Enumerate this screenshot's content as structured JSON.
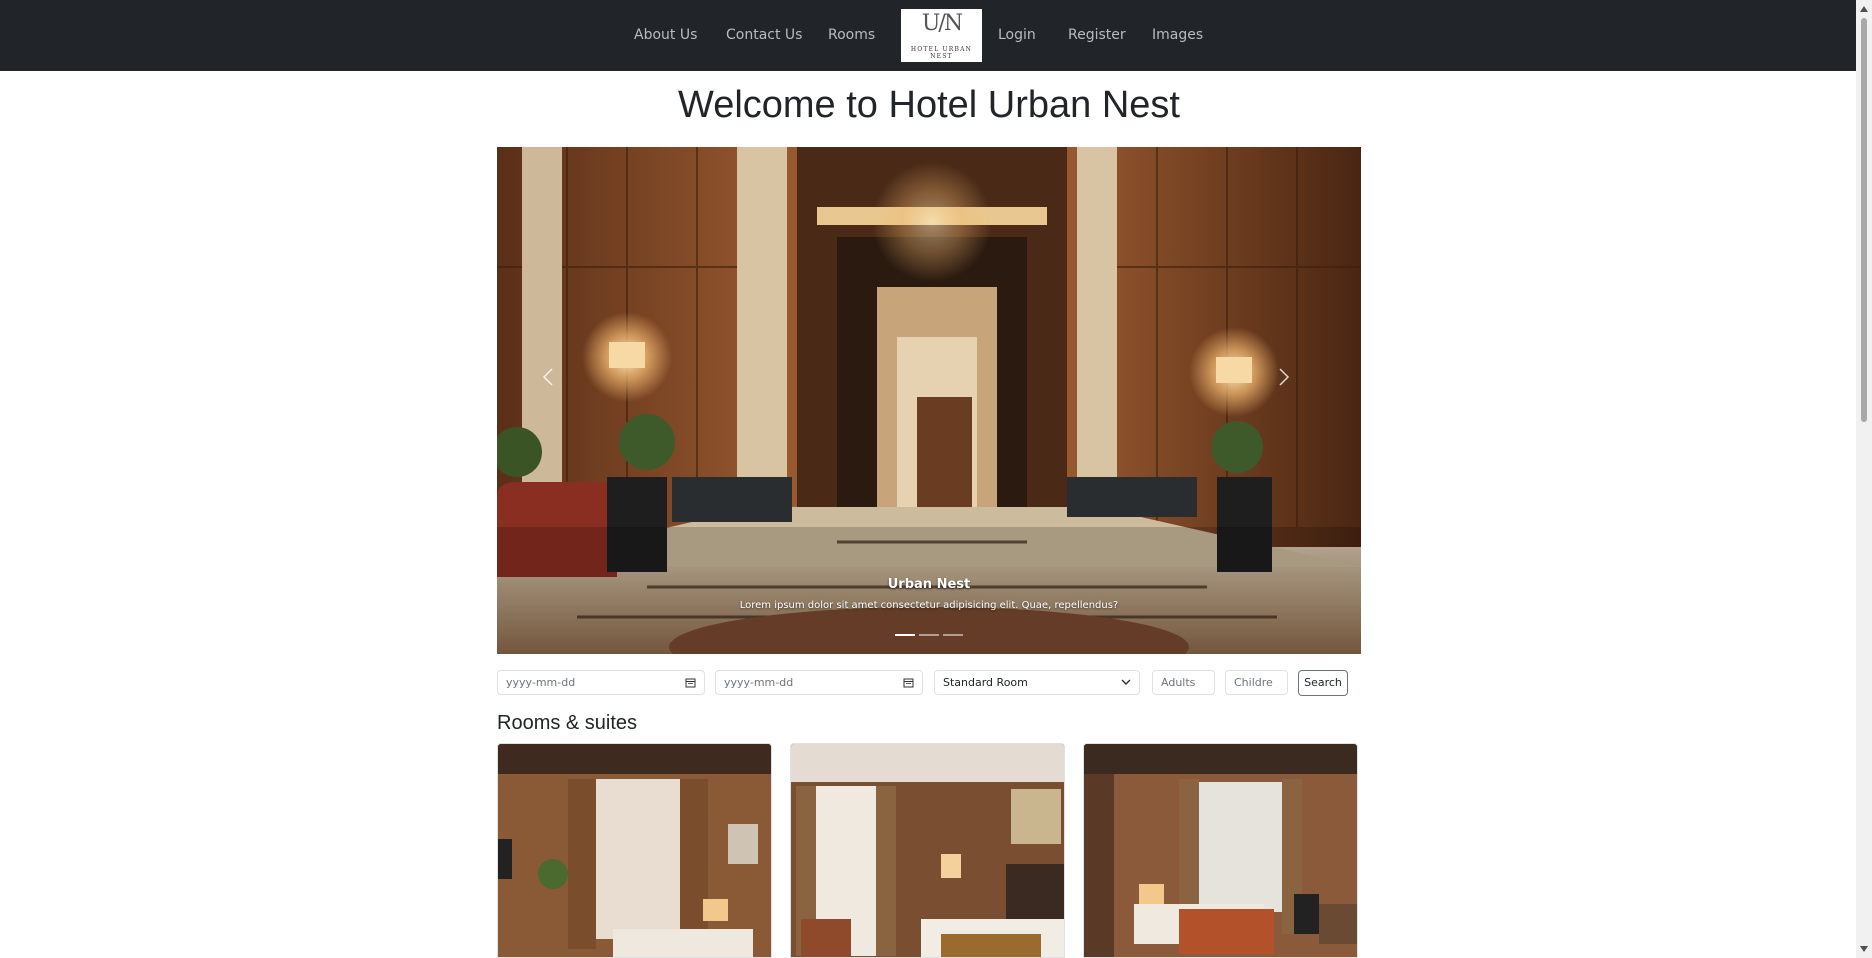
{
  "nav": {
    "links_left": [
      "About Us",
      "Contact Us",
      "Rooms"
    ],
    "links_right": [
      "Login",
      "Register",
      "Images"
    ],
    "logo": {
      "monogram": "U/N",
      "name": "HOTEL URBAN NEST"
    }
  },
  "page_title": "Welcome to Hotel Urban Nest",
  "carousel": {
    "caption_title": "Urban Nest",
    "caption_text": "Lorem ipsum dolor sit amet consectetur adipisicing elit. Quae, repellendus?",
    "slide_count": 3,
    "active_slide": 1
  },
  "booking": {
    "checkin_placeholder": "yyyy-mm-dd",
    "checkout_placeholder": "yyyy-mm-dd",
    "room_type_selected": "Standard Room",
    "adults_placeholder": "Adults",
    "children_placeholder": "Childre",
    "search_label": "Search"
  },
  "rooms_section_title": "Rooms & suites",
  "colors": {
    "navbar_bg": "#212529",
    "nav_link": "#b8bcc0",
    "wood": "#7a4526",
    "marble": "#c9b8a0"
  }
}
